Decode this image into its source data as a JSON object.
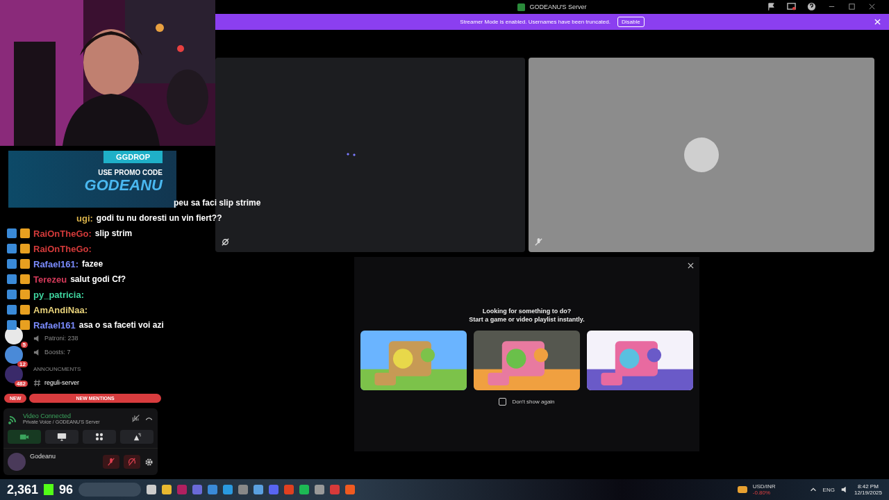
{
  "window": {
    "title": "GODEANU'S Server"
  },
  "streamer_banner": {
    "message": "Streamer Mode is enabled. Usernames have been truncated.",
    "button": "Disable"
  },
  "promo": {
    "brand": "GGDROP",
    "line": "USE PROMO CODE",
    "code": "GODEANU"
  },
  "chat": [
    {
      "text": "peu sa faci slip strime"
    },
    {
      "user": "ugi:",
      "color": "#d9b24a",
      "text": "godi tu nu doresti un vin fiert??"
    },
    {
      "user": "RaiOnTheGo:",
      "color": "#d43a3a",
      "text": "slip strim"
    },
    {
      "user": "RaiOnTheGo:",
      "color": "#d43a3a"
    },
    {
      "user": "Rafael161:",
      "color": "#7b8cff",
      "text": "fazee"
    },
    {
      "user": "Terezeu",
      "color": "#d43a5a",
      "text": "salut godi Cf?"
    },
    {
      "user": "py_patricia:",
      "color": "#3fd6a0"
    },
    {
      "user": "AmAndiNaa:",
      "color": "#e8d27a"
    },
    {
      "user": "Rafael161",
      "color": "#7b8cff",
      "text": "asa o sa faceti voi azi"
    }
  ],
  "servers": [
    {
      "badge": "5",
      "color": "#e8e8e8"
    },
    {
      "badge": "12",
      "color": "#4a8ad8"
    },
    {
      "badge": "482",
      "color": "#3a2a6a"
    }
  ],
  "channels": [
    {
      "kind": "stat",
      "label": "Patroni: 238"
    },
    {
      "kind": "stat",
      "label": "Boosts: 7"
    },
    {
      "kind": "category",
      "label": "ANNOUNCMENTS"
    },
    {
      "kind": "text",
      "label": "reguli-server"
    }
  ],
  "new_badge": "NEW",
  "new_mentions": "NEW MENTIONS",
  "voice": {
    "status": "Video Connected",
    "location": "Private Voice / GODEANU'S Server",
    "camera_on": true
  },
  "user": {
    "name": "Godeanu",
    "muted": true,
    "deafened": true
  },
  "activity_prompt": {
    "title": "Looking for something to do?",
    "subtitle": "Start a game or video playlist instantly.",
    "dont_show": {
      "label": "Don't show again",
      "checked": false
    }
  },
  "taskbar": {
    "stream_count": "2,361",
    "kick_count": "96",
    "ticker": "USD/INR",
    "ticker_change": "-0.80%",
    "language": "ENG",
    "time": "8:42 PM",
    "date": "12/19/2025"
  }
}
